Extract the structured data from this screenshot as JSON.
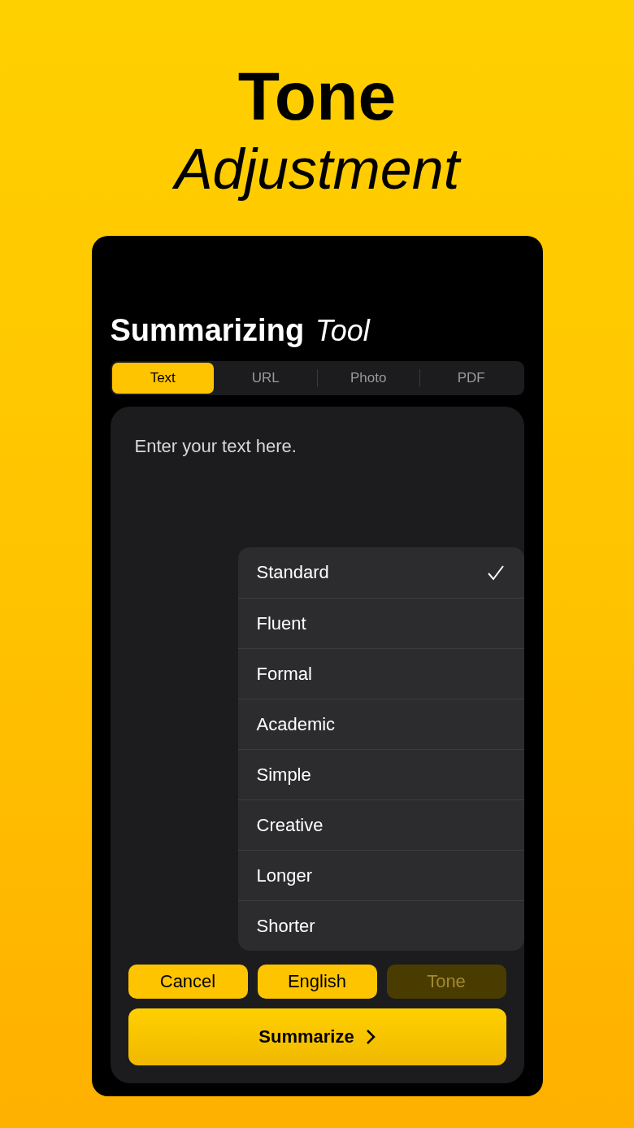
{
  "headline": {
    "line_1": "Tone",
    "line_2": "Adjustment"
  },
  "app": {
    "title": "Summarizing",
    "title_italic": "Tool"
  },
  "tabs": [
    {
      "label": "Text",
      "selected": true
    },
    {
      "label": "URL",
      "selected": false
    },
    {
      "label": "Photo",
      "selected": false
    },
    {
      "label": "PDF",
      "selected": false
    }
  ],
  "input": {
    "placeholder": "Enter your text here."
  },
  "tone_menu": [
    {
      "label": "Standard",
      "selected": true
    },
    {
      "label": "Fluent",
      "selected": false
    },
    {
      "label": "Formal",
      "selected": false
    },
    {
      "label": "Academic",
      "selected": false
    },
    {
      "label": "Simple",
      "selected": false
    },
    {
      "label": "Creative",
      "selected": false
    },
    {
      "label": "Longer",
      "selected": false
    },
    {
      "label": "Shorter",
      "selected": false
    }
  ],
  "buttons": [
    {
      "label": "Cancel",
      "disabled": false
    },
    {
      "label": "English",
      "disabled": false
    },
    {
      "label": "Tone",
      "disabled": true
    }
  ],
  "primary_button": {
    "label": "Summarize"
  }
}
